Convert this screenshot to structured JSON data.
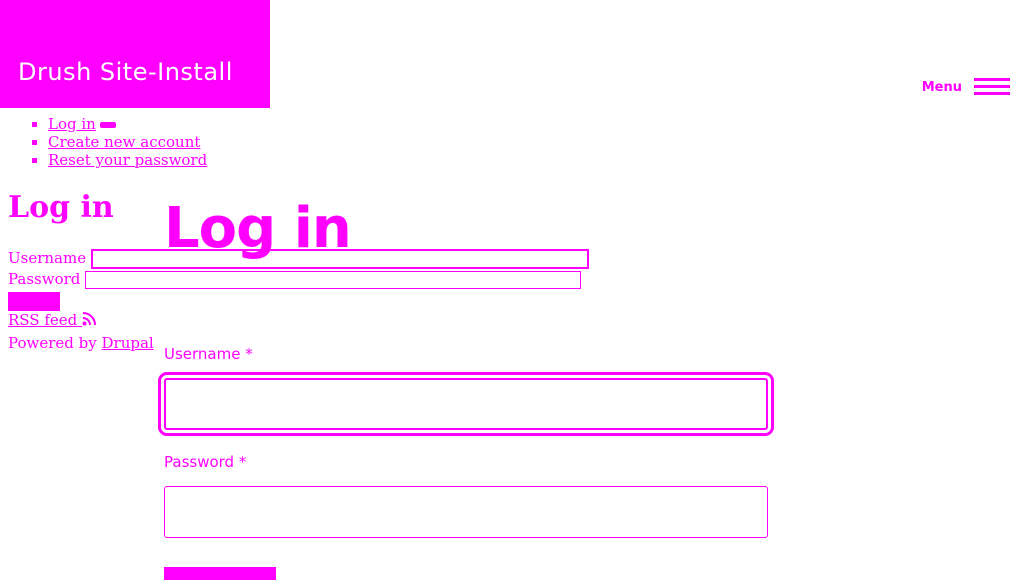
{
  "site": {
    "name": "Drush Site-Install"
  },
  "header": {
    "menu_label": "Menu"
  },
  "tabs": [
    {
      "label": "Log in"
    },
    {
      "label": "Create new account"
    },
    {
      "label": "Reset your password"
    }
  ],
  "plain_form": {
    "title": "Log in",
    "username_label": "Username",
    "password_label": "Password",
    "username_value": "",
    "password_value": ""
  },
  "footer": {
    "rss_label": "RSS feed",
    "powered_by": "Powered by",
    "drupal_link": "Drupal"
  },
  "styled_form": {
    "title": "Log in",
    "username_label": "Username",
    "password_label": "Password",
    "required_mark": "*",
    "username_value": "",
    "password_value": ""
  },
  "colors": {
    "accent": "#ff00ff",
    "background": "#ffffff"
  }
}
